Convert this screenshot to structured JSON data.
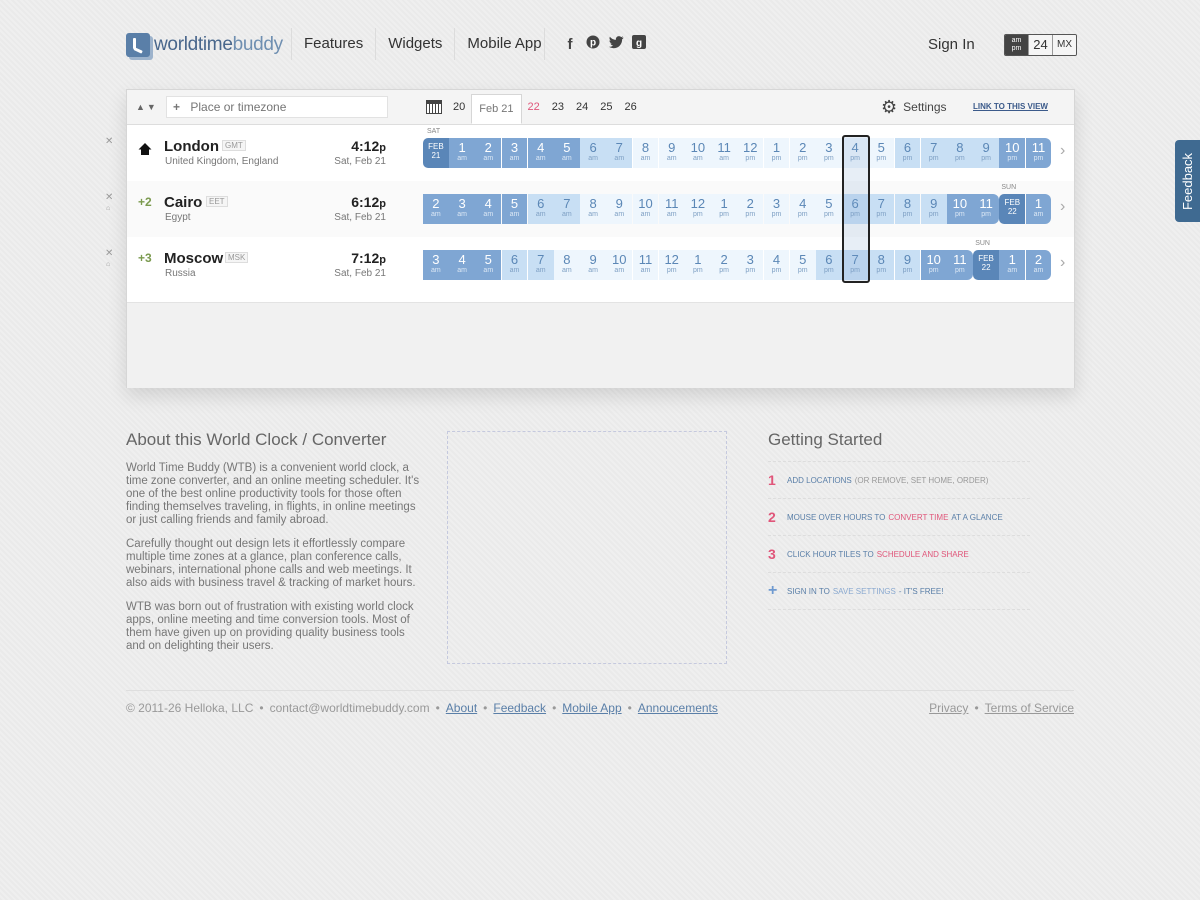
{
  "header": {
    "logo": {
      "part1": "worldtime",
      "part2": "buddy"
    },
    "nav": [
      "Features",
      "Widgets",
      "Mobile App"
    ],
    "social": [
      "f",
      "p",
      "t",
      "g"
    ],
    "sign_in": "Sign In",
    "format": {
      "ampm_top": "am",
      "ampm_bottom": "pm",
      "h24": "24",
      "mx": "MX"
    }
  },
  "toolbar": {
    "sort": "▲▼",
    "search_plus": "+",
    "search_placeholder": "Place or timezone",
    "dates": [
      {
        "label": "20",
        "state": "normal"
      },
      {
        "label": "Feb 21",
        "state": "active"
      },
      {
        "label": "22",
        "state": "red"
      },
      {
        "label": "23",
        "state": "normal"
      },
      {
        "label": "24",
        "state": "normal"
      },
      {
        "label": "25",
        "state": "normal"
      },
      {
        "label": "26",
        "state": "normal"
      }
    ],
    "settings": "Settings",
    "link_view": "LINK TO THIS VIEW"
  },
  "locations": [
    {
      "city": "London",
      "tz": "GMT",
      "country": "United Kingdom, England",
      "offset": "",
      "time": "4:12",
      "ampm": "p",
      "date": "Sat, Feb 21",
      "day_label": "SAT",
      "hours": [
        {
          "h": "FEB",
          "p": "21",
          "k": "dayst"
        },
        {
          "h": "1",
          "p": "am",
          "k": "night"
        },
        {
          "h": "2",
          "p": "am",
          "k": "night"
        },
        {
          "h": "3",
          "p": "am",
          "k": "night"
        },
        {
          "h": "4",
          "p": "am",
          "k": "night"
        },
        {
          "h": "5",
          "p": "am",
          "k": "night"
        },
        {
          "h": "6",
          "p": "am",
          "k": "dawn"
        },
        {
          "h": "7",
          "p": "am",
          "k": "dawn"
        },
        {
          "h": "8",
          "p": "am",
          "k": "day"
        },
        {
          "h": "9",
          "p": "am",
          "k": "day"
        },
        {
          "h": "10",
          "p": "am",
          "k": "day"
        },
        {
          "h": "11",
          "p": "am",
          "k": "day"
        },
        {
          "h": "12",
          "p": "pm",
          "k": "day"
        },
        {
          "h": "1",
          "p": "pm",
          "k": "day"
        },
        {
          "h": "2",
          "p": "pm",
          "k": "day"
        },
        {
          "h": "3",
          "p": "pm",
          "k": "day"
        },
        {
          "h": "4",
          "p": "pm",
          "k": "day"
        },
        {
          "h": "5",
          "p": "pm",
          "k": "day"
        },
        {
          "h": "6",
          "p": "pm",
          "k": "dawn"
        },
        {
          "h": "7",
          "p": "pm",
          "k": "dawn"
        },
        {
          "h": "8",
          "p": "pm",
          "k": "dawn"
        },
        {
          "h": "9",
          "p": "pm",
          "k": "dawn"
        },
        {
          "h": "10",
          "p": "pm",
          "k": "night"
        },
        {
          "h": "11",
          "p": "pm",
          "k": "night"
        }
      ]
    },
    {
      "city": "Cairo",
      "tz": "EET",
      "country": "Egypt",
      "offset": "+2",
      "time": "6:12",
      "ampm": "p",
      "date": "Sat, Feb 21",
      "day_label": "SUN",
      "hours": [
        {
          "h": "2",
          "p": "am",
          "k": "night"
        },
        {
          "h": "3",
          "p": "am",
          "k": "night"
        },
        {
          "h": "4",
          "p": "am",
          "k": "night"
        },
        {
          "h": "5",
          "p": "am",
          "k": "night"
        },
        {
          "h": "6",
          "p": "am",
          "k": "dawn"
        },
        {
          "h": "7",
          "p": "am",
          "k": "dawn"
        },
        {
          "h": "8",
          "p": "am",
          "k": "day"
        },
        {
          "h": "9",
          "p": "am",
          "k": "day"
        },
        {
          "h": "10",
          "p": "am",
          "k": "day"
        },
        {
          "h": "11",
          "p": "am",
          "k": "day"
        },
        {
          "h": "12",
          "p": "pm",
          "k": "day"
        },
        {
          "h": "1",
          "p": "pm",
          "k": "day"
        },
        {
          "h": "2",
          "p": "pm",
          "k": "day"
        },
        {
          "h": "3",
          "p": "pm",
          "k": "day"
        },
        {
          "h": "4",
          "p": "pm",
          "k": "day"
        },
        {
          "h": "5",
          "p": "pm",
          "k": "day"
        },
        {
          "h": "6",
          "p": "pm",
          "k": "dawn"
        },
        {
          "h": "7",
          "p": "pm",
          "k": "dawn"
        },
        {
          "h": "8",
          "p": "pm",
          "k": "dawn"
        },
        {
          "h": "9",
          "p": "pm",
          "k": "dawn"
        },
        {
          "h": "10",
          "p": "pm",
          "k": "night"
        },
        {
          "h": "11",
          "p": "pm",
          "k": "night"
        },
        {
          "h": "FEB",
          "p": "22",
          "k": "dayst"
        },
        {
          "h": "1",
          "p": "am",
          "k": "night"
        }
      ]
    },
    {
      "city": "Moscow",
      "tz": "MSK",
      "country": "Russia",
      "offset": "+3",
      "time": "7:12",
      "ampm": "p",
      "date": "Sat, Feb 21",
      "day_label": "SUN",
      "hours": [
        {
          "h": "3",
          "p": "am",
          "k": "night"
        },
        {
          "h": "4",
          "p": "am",
          "k": "night"
        },
        {
          "h": "5",
          "p": "am",
          "k": "night"
        },
        {
          "h": "6",
          "p": "am",
          "k": "dawn"
        },
        {
          "h": "7",
          "p": "am",
          "k": "dawn"
        },
        {
          "h": "8",
          "p": "am",
          "k": "day"
        },
        {
          "h": "9",
          "p": "am",
          "k": "day"
        },
        {
          "h": "10",
          "p": "am",
          "k": "day"
        },
        {
          "h": "11",
          "p": "am",
          "k": "day"
        },
        {
          "h": "12",
          "p": "pm",
          "k": "day"
        },
        {
          "h": "1",
          "p": "pm",
          "k": "day"
        },
        {
          "h": "2",
          "p": "pm",
          "k": "day"
        },
        {
          "h": "3",
          "p": "pm",
          "k": "day"
        },
        {
          "h": "4",
          "p": "pm",
          "k": "day"
        },
        {
          "h": "5",
          "p": "pm",
          "k": "day"
        },
        {
          "h": "6",
          "p": "pm",
          "k": "dawn"
        },
        {
          "h": "7",
          "p": "pm",
          "k": "dawn"
        },
        {
          "h": "8",
          "p": "pm",
          "k": "dawn"
        },
        {
          "h": "9",
          "p": "pm",
          "k": "dawn"
        },
        {
          "h": "10",
          "p": "pm",
          "k": "night"
        },
        {
          "h": "11",
          "p": "pm",
          "k": "night"
        },
        {
          "h": "FEB",
          "p": "22",
          "k": "dayst"
        },
        {
          "h": "1",
          "p": "am",
          "k": "night"
        },
        {
          "h": "2",
          "p": "am",
          "k": "night"
        }
      ]
    }
  ],
  "about": {
    "title": "About this World Clock / Converter",
    "p1": "World Time Buddy (WTB) is a convenient world clock, a time zone converter, and an online meeting scheduler. It's one of the best online productivity tools for those often finding themselves traveling, in flights, in online meetings or just calling friends and family abroad.",
    "p2": "Carefully thought out design lets it effortlessly compare multiple time zones at a glance, plan conference calls, webinars, international phone calls and web meetings. It also aids with business travel & tracking of market hours.",
    "p3": "WTB was born out of frustration with existing world clock apps, online meeting and time conversion tools. Most of them have given up on providing quality business tools and on delighting their users."
  },
  "getting_started": {
    "title": "Getting Started",
    "items": [
      {
        "num": "1",
        "a": "ADD LOCATIONS",
        "b": "(OR REMOVE, SET HOME, ORDER)",
        "c": "",
        "d": ""
      },
      {
        "num": "2",
        "a": "MOUSE OVER HOURS TO",
        "b": "CONVERT TIME",
        "c": "AT A GLANCE",
        "d": ""
      },
      {
        "num": "3",
        "a": "CLICK HOUR TILES TO",
        "b": "SCHEDULE AND SHARE",
        "c": "",
        "d": ""
      },
      {
        "num": "+",
        "a": "SIGN IN TO",
        "b": "SAVE SETTINGS",
        "c": "- IT'S FREE!",
        "d": ""
      }
    ]
  },
  "footer": {
    "copyright": "© 2011-26 Helloka, LLC",
    "email": "contact@worldtimebuddy.com",
    "links": [
      "About",
      "Feedback",
      "Mobile App",
      "Annoucements"
    ],
    "right_links": [
      "Privacy",
      "Terms of Service"
    ],
    "bullet": "•"
  },
  "feedback_tab": "Feedback"
}
